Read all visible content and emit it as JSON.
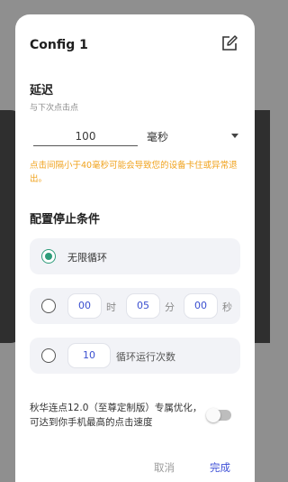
{
  "dialog": {
    "title": "Config 1",
    "delay": {
      "heading": "延迟",
      "subtitle": "与下次点击点",
      "value": "100",
      "unit": "毫秒"
    },
    "warning": "点击间隔小于40毫秒可能会导致您的设备卡住或异常退出。",
    "stop_condition": {
      "heading": "配置停止条件",
      "infinite_label": "无限循环",
      "timer": {
        "hours": "00",
        "hours_unit": "时",
        "minutes": "05",
        "minutes_unit": "分",
        "seconds": "00",
        "seconds_unit": "秒"
      },
      "loop": {
        "count": "10",
        "label": "循环运行次数"
      },
      "selected": "infinite"
    },
    "optimize_text": "秋华连点12.0（至尊定制版）专属优化，可达到你手机最高的点击速度",
    "optimize_enabled": false,
    "buttons": {
      "cancel": "取消",
      "done": "完成"
    }
  },
  "colors": {
    "accent_green": "#2e9c7a",
    "accent_blue": "#3d4fd6",
    "warning_orange": "#f0a21c",
    "card_bg": "#f2f3f7"
  },
  "icons": [
    "edit-icon",
    "dropdown-caret-icon",
    "radio-checked-icon",
    "radio-unchecked-icon"
  ]
}
